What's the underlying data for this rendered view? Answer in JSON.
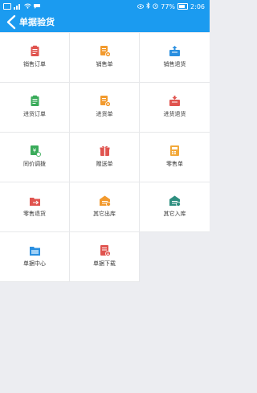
{
  "status_bar": {
    "battery": "77%",
    "time": "2:06"
  },
  "header": {
    "title": "单据验货"
  },
  "grid": {
    "items": [
      {
        "label": "销售订单",
        "icon": "sales-order-icon",
        "color": "#e0544f"
      },
      {
        "label": "销售单",
        "icon": "sales-invoice-icon",
        "color": "#f29a2e"
      },
      {
        "label": "销售退货",
        "icon": "sales-return-icon",
        "color": "#2a8fe0"
      },
      {
        "label": "进货订单",
        "icon": "purchase-order-icon",
        "color": "#3aab5a"
      },
      {
        "label": "进货单",
        "icon": "purchase-invoice-icon",
        "color": "#f29a2e"
      },
      {
        "label": "进货退货",
        "icon": "purchase-return-icon",
        "color": "#e0544f"
      },
      {
        "label": "同价调拨",
        "icon": "price-transfer-icon",
        "color": "#3aab5a"
      },
      {
        "label": "赠送单",
        "icon": "gift-icon",
        "color": "#e0544f"
      },
      {
        "label": "零售单",
        "icon": "retail-icon",
        "color": "#f2a93b"
      },
      {
        "label": "零售退货",
        "icon": "retail-return-icon",
        "color": "#e0544f"
      },
      {
        "label": "其它出库",
        "icon": "warehouse-out-icon",
        "color": "#f29a2e"
      },
      {
        "label": "其它入库",
        "icon": "warehouse-in-icon",
        "color": "#2e8f80"
      },
      {
        "label": "单据中心",
        "icon": "document-center-icon",
        "color": "#2a8fe0"
      },
      {
        "label": "单据下载",
        "icon": "document-download-icon",
        "color": "#e0544f"
      }
    ]
  }
}
